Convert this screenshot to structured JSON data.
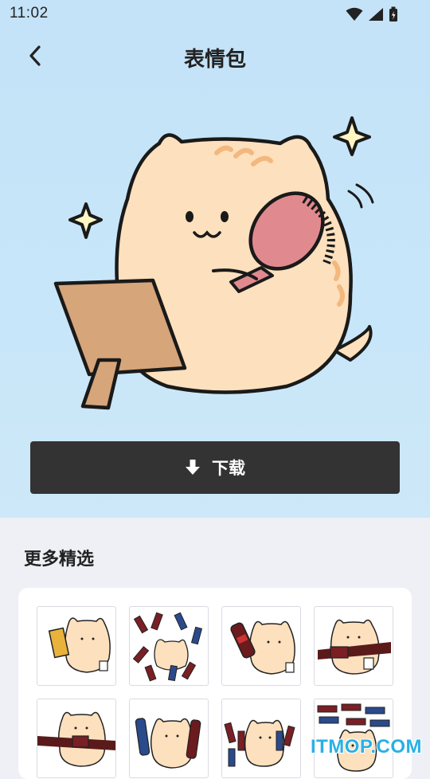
{
  "status_bar": {
    "time": "11:02"
  },
  "header": {
    "title": "表情包"
  },
  "actions": {
    "download_label": "下载"
  },
  "more": {
    "title": "更多精选",
    "items": [
      {
        "name": "cat-with-drink"
      },
      {
        "name": "cat-surrounded-by-bottles"
      },
      {
        "name": "cat-with-cola-bottle"
      },
      {
        "name": "cat-pouring-cola"
      },
      {
        "name": "cat-spilling-cola"
      },
      {
        "name": "cat-with-two-bottles"
      },
      {
        "name": "cat-bottles-crowd"
      },
      {
        "name": "cat-bottles-rows"
      }
    ]
  },
  "watermark": "ITMOP.COM",
  "colors": {
    "button": "#333333",
    "hero_bg": "#c7e6f9",
    "cat_fill": "#fde0bd",
    "stripe": "#f3b87e",
    "watermark": "#29b0e6"
  }
}
